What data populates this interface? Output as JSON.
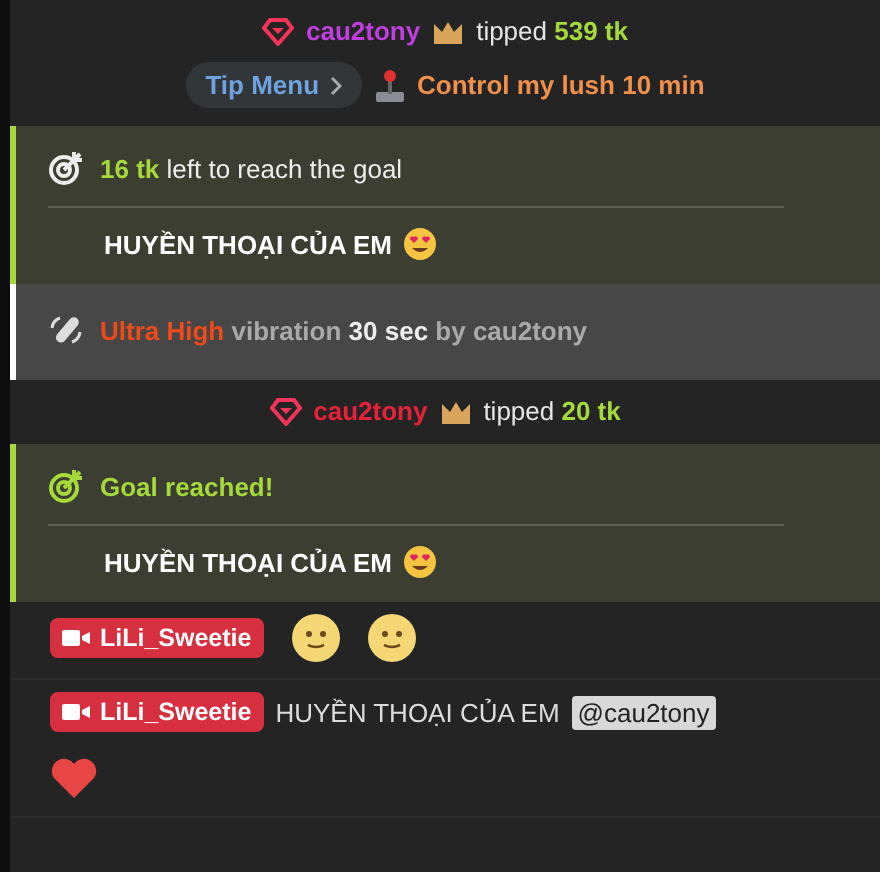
{
  "messages": [
    {
      "kind": "tip",
      "username": "cau2tony",
      "color": "#c13fe0",
      "verb": "tipped",
      "amount": "539 tk",
      "menu_button": "Tip Menu",
      "menu_item": "Control my lush 10 min"
    },
    {
      "kind": "goal",
      "reached": false,
      "amount": "16 tk",
      "text": "left to reach the goal",
      "goal_title": "HUYỀN THOẠI CỦA EM"
    },
    {
      "kind": "vibration",
      "level": "Ultra High",
      "text": "vibration",
      "duration": "30 sec",
      "by": "by cau2tony"
    },
    {
      "kind": "tip",
      "username": "cau2tony",
      "color": "#e8213b",
      "verb": "tipped",
      "amount": "20 tk"
    },
    {
      "kind": "goal",
      "reached": true,
      "text": "Goal reached!",
      "goal_title": "HUYỀN THOẠI CỦA EM"
    },
    {
      "kind": "chat",
      "username": "LiLi_Sweetie",
      "emojis": [
        {
          "kind": "slight-smile"
        },
        {
          "kind": "slight-smile"
        }
      ]
    },
    {
      "kind": "chat",
      "username": "LiLi_Sweetie",
      "text": "HUYỀN THOẠI CỦA EM",
      "mention": "@cau2tony",
      "emojis": [
        {
          "kind": "heart"
        }
      ]
    }
  ]
}
